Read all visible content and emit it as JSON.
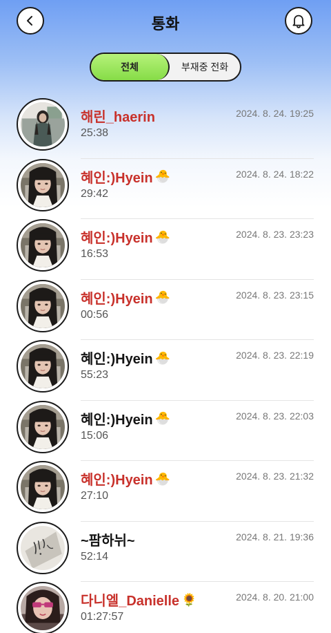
{
  "header": {
    "title": "통화",
    "back_icon": "chevron-left-icon",
    "bell_icon": "bell-icon"
  },
  "tabs": [
    {
      "label": "전체",
      "selected": true
    },
    {
      "label": "부재중 전화",
      "selected": false
    }
  ],
  "colors": {
    "missed": "#c8312b",
    "normal": "#141414",
    "tab_active": "#93e052"
  },
  "calls": [
    {
      "name": "해린_haerin",
      "emoji": "",
      "duration": "25:38",
      "date": "2024. 8. 24. 19:25",
      "missed": true,
      "avatar": "haerin"
    },
    {
      "name": "혜인:)Hyein",
      "emoji": "🐣",
      "duration": "29:42",
      "date": "2024. 8. 24. 18:22",
      "missed": true,
      "avatar": "hyein"
    },
    {
      "name": "혜인:)Hyein",
      "emoji": "🐣",
      "duration": "16:53",
      "date": "2024. 8. 23. 23:23",
      "missed": true,
      "avatar": "hyein"
    },
    {
      "name": "혜인:)Hyein",
      "emoji": "🐣",
      "duration": "00:56",
      "date": "2024. 8. 23. 23:15",
      "missed": true,
      "avatar": "hyein"
    },
    {
      "name": "혜인:)Hyein",
      "emoji": "🐣",
      "duration": "55:23",
      "date": "2024. 8. 23. 22:19",
      "missed": false,
      "avatar": "hyein"
    },
    {
      "name": "혜인:)Hyein",
      "emoji": "🐣",
      "duration": "15:06",
      "date": "2024. 8. 23. 22:03",
      "missed": false,
      "avatar": "hyein"
    },
    {
      "name": "혜인:)Hyein",
      "emoji": "🐣",
      "duration": "27:10",
      "date": "2024. 8. 23. 21:32",
      "missed": true,
      "avatar": "hyein"
    },
    {
      "name": "~팜하뉘~",
      "emoji": "",
      "duration": "52:14",
      "date": "2024. 8. 21. 19:36",
      "missed": false,
      "avatar": "hanni"
    },
    {
      "name": "다니엘_Danielle",
      "emoji": "🌻",
      "duration": "01:27:57",
      "date": "2024. 8. 20. 21:00",
      "missed": true,
      "avatar": "danielle"
    }
  ]
}
